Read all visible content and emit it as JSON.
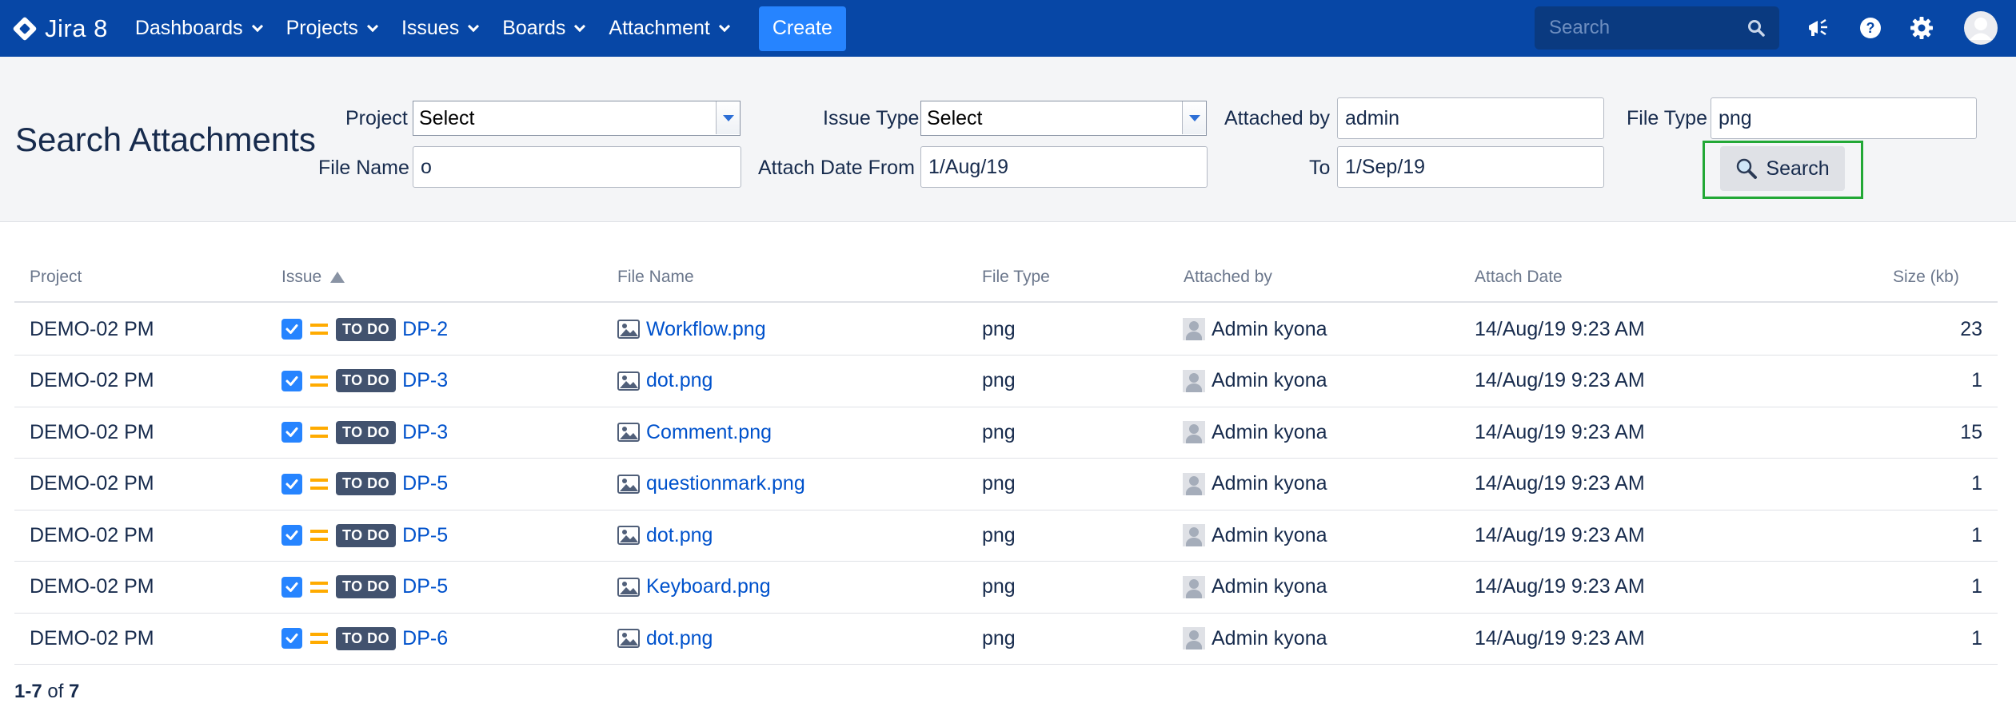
{
  "app": {
    "logo_text": "Jira 8"
  },
  "nav": {
    "items": [
      {
        "label": "Dashboards"
      },
      {
        "label": "Projects"
      },
      {
        "label": "Issues"
      },
      {
        "label": "Boards"
      },
      {
        "label": "Attachment"
      }
    ],
    "create_label": "Create",
    "search_placeholder": "Search"
  },
  "page": {
    "title": "Search Attachments"
  },
  "filters": {
    "project_label": "Project",
    "project_value": "Select",
    "issue_type_label": "Issue Type",
    "issue_type_value": "Select",
    "attached_by_label": "Attached by",
    "attached_by_value": "admin",
    "file_type_label": "File Type",
    "file_type_value": "png",
    "file_name_label": "File Name",
    "file_name_value": "o",
    "date_from_label": "Attach Date From",
    "date_from_value": "1/Aug/19",
    "date_to_label": "To",
    "date_to_value": "1/Sep/19",
    "search_button_label": "Search"
  },
  "table": {
    "headers": {
      "project": "Project",
      "issue": "Issue",
      "file_name": "File Name",
      "file_type": "File Type",
      "attached_by": "Attached by",
      "attach_date": "Attach Date",
      "size": "Size (kb)"
    },
    "rows": [
      {
        "project": "DEMO-02 PM",
        "status": "TO DO",
        "issue": "DP-2",
        "file": "Workflow.png",
        "type": "png",
        "by": "Admin kyona",
        "date": "14/Aug/19 9:23 AM",
        "size": "23"
      },
      {
        "project": "DEMO-02 PM",
        "status": "TO DO",
        "issue": "DP-3",
        "file": "dot.png",
        "type": "png",
        "by": "Admin kyona",
        "date": "14/Aug/19 9:23 AM",
        "size": "1"
      },
      {
        "project": "DEMO-02 PM",
        "status": "TO DO",
        "issue": "DP-3",
        "file": "Comment.png",
        "type": "png",
        "by": "Admin kyona",
        "date": "14/Aug/19 9:23 AM",
        "size": "15"
      },
      {
        "project": "DEMO-02 PM",
        "status": "TO DO",
        "issue": "DP-5",
        "file": "questionmark.png",
        "type": "png",
        "by": "Admin kyona",
        "date": "14/Aug/19 9:23 AM",
        "size": "1"
      },
      {
        "project": "DEMO-02 PM",
        "status": "TO DO",
        "issue": "DP-5",
        "file": "dot.png",
        "type": "png",
        "by": "Admin kyona",
        "date": "14/Aug/19 9:23 AM",
        "size": "1"
      },
      {
        "project": "DEMO-02 PM",
        "status": "TO DO",
        "issue": "DP-5",
        "file": "Keyboard.png",
        "type": "png",
        "by": "Admin kyona",
        "date": "14/Aug/19 9:23 AM",
        "size": "1"
      },
      {
        "project": "DEMO-02 PM",
        "status": "TO DO",
        "issue": "DP-6",
        "file": "dot.png",
        "type": "png",
        "by": "Admin kyona",
        "date": "14/Aug/19 9:23 AM",
        "size": "1"
      }
    ]
  },
  "pagination": {
    "range": "1-7",
    "of": "of",
    "total": "7"
  },
  "colors": {
    "nav_bg": "#0747a6",
    "accent": "#2684ff",
    "link": "#0052cc",
    "highlight_frame": "#22a836",
    "lozenge": "#42526e",
    "priority": "#ffab00"
  },
  "icons": {
    "logo": "jira-diamond-icon",
    "search": "magnifier-icon",
    "announce": "megaphone-icon",
    "help": "question-icon",
    "settings": "gear-icon",
    "user": "avatar-icon",
    "checkbox": "checkbox-checked-icon",
    "priority": "priority-medium-icon",
    "attachment": "image-file-icon",
    "sort": "sort-ascending-icon"
  }
}
